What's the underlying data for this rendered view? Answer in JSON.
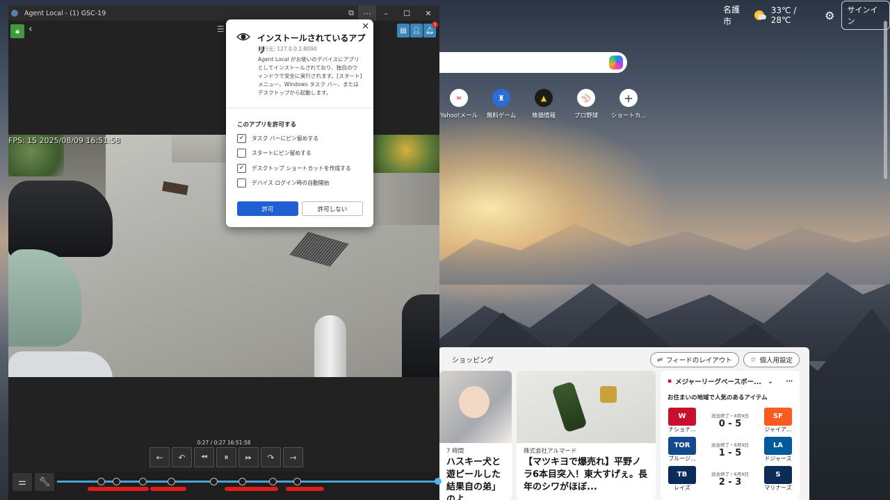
{
  "browser": {
    "location": "名護市",
    "temperature": "33℃ / 28℃",
    "signin_label": "サインイン",
    "shortcuts": [
      {
        "label": "Yahoo!メール",
        "icon": "yahoo-mail-icon"
      },
      {
        "label": "無料ゲーム",
        "icon": "games-icon"
      },
      {
        "label": "株価情報",
        "icon": "stocks-icon"
      },
      {
        "label": "プロ野球",
        "icon": "baseball-icon"
      },
      {
        "label": "ショートカ...",
        "icon": "plus-icon"
      }
    ],
    "feed": {
      "tab_label": "ショッピング",
      "layout_button": "フィードのレイアウト",
      "personal_button": "個人用設定",
      "cards": [
        {
          "meta": "7 時間",
          "title": "ハスキー犬と遊ピールした結果自の弟」のよ..."
        },
        {
          "meta": "株式会社アルマード",
          "title": "【マツキヨで爆売れ】平野ノラ6本目突入！東大すげぇ。長年のシワがほぼ..."
        }
      ],
      "scores": {
        "header": "メジャーリーグベースボー...",
        "subtitle": "お住まいの地域で人気のあるアイテム",
        "games": [
          {
            "home": "ナショナ...",
            "home_logo": "W",
            "home_color": "#c8102e",
            "status": "試合終了・8月9日",
            "score": "0 - 5",
            "away": "ジャイア...",
            "away_logo": "SF",
            "away_color": "#fd5a1e"
          },
          {
            "home": "ブルージ...",
            "home_logo": "TOR",
            "home_color": "#134a8e",
            "status": "試合終了・8月9日",
            "score": "1 - 5",
            "away": "ドジャース",
            "away_logo": "LA",
            "away_color": "#005a9c"
          },
          {
            "home": "レイズ",
            "home_logo": "TB",
            "home_color": "#092c5c",
            "status": "試合終了・8月9日",
            "score": "2 - 3",
            "away": "マリナーズ",
            "away_logo": "S",
            "away_color": "#0c2c56"
          }
        ]
      }
    }
  },
  "agent": {
    "window_title": "Agent Local - (1) GSC-19",
    "notification_count": "1",
    "osd_text": "FPS: 15 2025/08/09 16:51:58",
    "playback_time": "0:27 / 0:27 16:51:58",
    "timeline": {
      "markers": [
        0.115,
        0.155,
        0.225,
        0.3,
        0.41,
        0.485,
        0.565,
        0.63
      ],
      "events": [
        [
          0.08,
          0.24
        ],
        [
          0.245,
          0.34
        ],
        [
          0.44,
          0.58
        ],
        [
          0.6,
          0.7
        ]
      ]
    }
  },
  "dialog": {
    "title": "インストールされているアプリ",
    "origin": "発行元: 127.0.0.1:8090",
    "description": "Agent Local がお使いのデバイスにアプリとしてインストールされており、独自のウィンドウで安全に実行されます。[スタート] メニュー、Windows タスク バー、またはデスクトップから起動します。",
    "permission_heading": "このアプリを許可する",
    "options": [
      {
        "label": "タスク バーにピン留めする",
        "checked": true
      },
      {
        "label": "スタートにピン留めする",
        "checked": false
      },
      {
        "label": "デスクトップ ショートカットを作成する",
        "checked": true
      },
      {
        "label": "デバイス ログイン時の自動開始",
        "checked": false
      }
    ],
    "allow_label": "許可",
    "deny_label": "許可しない"
  }
}
